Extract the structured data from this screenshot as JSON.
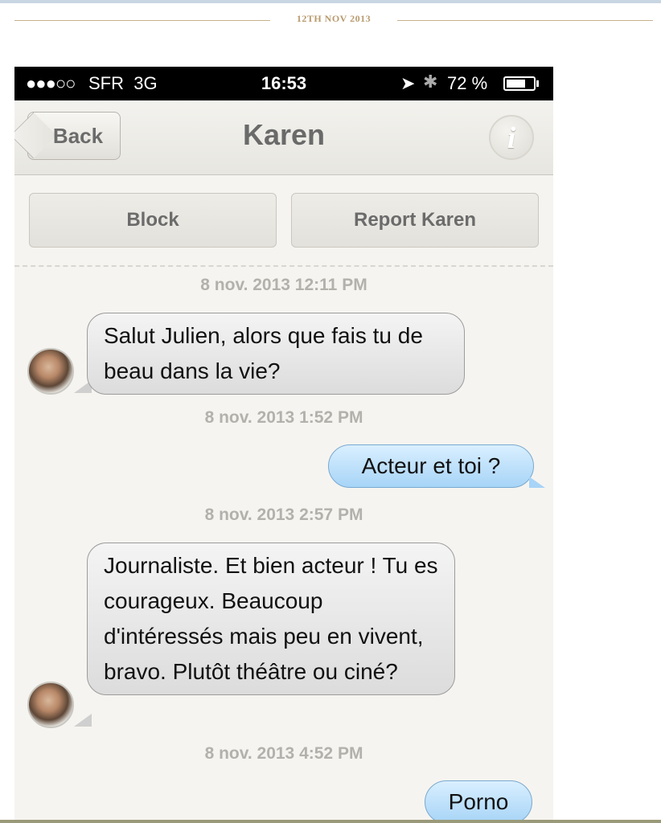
{
  "page": {
    "date_label": "12TH NOV 2013"
  },
  "status_bar": {
    "signal": "●●●○○",
    "carrier": "SFR",
    "network": "3G",
    "time": "16:53",
    "battery_text": "72 %",
    "battery_level": 0.72
  },
  "nav": {
    "back_label": "Back",
    "title": "Karen",
    "info_label": "i"
  },
  "actions": {
    "block_label": "Block",
    "report_label": "Report Karen"
  },
  "messages": [
    {
      "timestamp": "8 nov. 2013 12:11 PM",
      "from": "Karen",
      "text": "Salut Julien, alors que fais tu de beau dans la vie?"
    },
    {
      "timestamp": "8 nov. 2013 1:52 PM",
      "from": "me",
      "text": "Acteur et toi ?"
    },
    {
      "timestamp": "8 nov. 2013 2:57 PM",
      "from": "Karen",
      "text": "Journaliste. Et bien acteur ! Tu es courageux. Beaucoup d'intéressés mais peu en vivent, bravo. Plutôt théâtre ou ciné?"
    },
    {
      "timestamp": "8 nov. 2013 4:52 PM",
      "from": "me",
      "text": "Porno"
    }
  ],
  "colors": {
    "incoming_bubble": "#dcdcdc",
    "outgoing_bubble": "#a7d4f7",
    "date_accent": "#b89a6e"
  }
}
